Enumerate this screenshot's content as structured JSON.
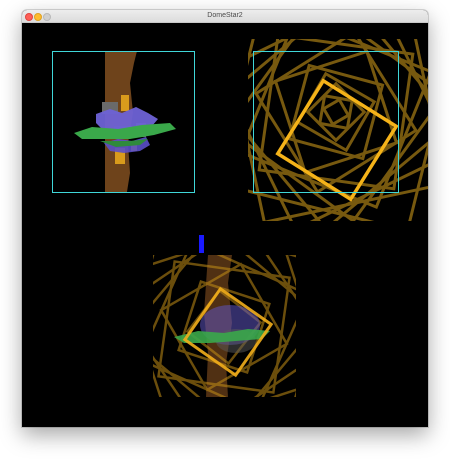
{
  "window": {
    "title": "DomeStar2"
  },
  "colors": {
    "background": "#000000",
    "frame_outline": "#3fd6d8",
    "orange": "#f2b01e",
    "indicator": "#1a1aff",
    "green": "#3aa84a",
    "purple": "#6e62d6"
  },
  "panels": [
    {
      "name": "camera-view-panel"
    },
    {
      "name": "square-pattern-panel"
    },
    {
      "name": "composite-output-panel"
    }
  ]
}
